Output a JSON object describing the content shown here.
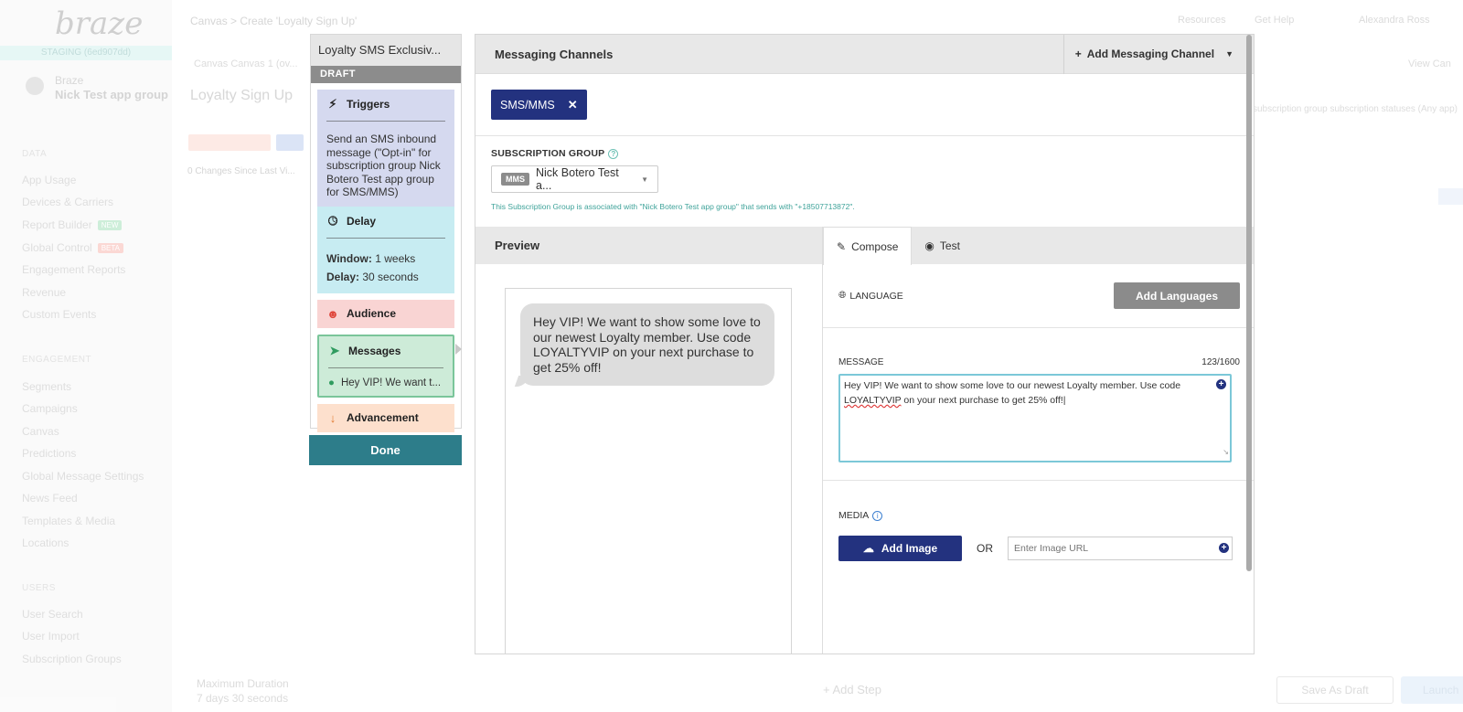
{
  "background": {
    "logo": "braze",
    "env_label": "STAGING (6ed907dd)",
    "company": "Braze",
    "app_group": "Nick Test app group",
    "breadcrumb": "Canvas > Create 'Loyalty Sign Up'",
    "resources": "Resources",
    "get_help": "Get Help",
    "user_name": "Alexandra Ross",
    "page_title": "Loyalty Sign Up",
    "changes": "0 Changes Since Last Vi...",
    "tabs": "Canvas     Canvas 1 (ov...",
    "right_hint": "subscription group subscription statuses (Any app)",
    "view_label": "View Can",
    "nav_head_1": "DATA",
    "nav_items_1": [
      "App Usage",
      "Devices & Carriers",
      "Report Builder",
      "Global Control",
      "Engagement Reports",
      "Revenue",
      "Custom Events"
    ],
    "report_builder_tag": "NEW",
    "global_control_tag": "BETA",
    "nav_head_2": "ENGAGEMENT",
    "nav_items_2": [
      "Segments",
      "Campaigns",
      "Canvas",
      "Predictions",
      "Global Message Settings",
      "News Feed",
      "Templates & Media",
      "Locations"
    ],
    "nav_head_3": "USERS",
    "nav_items_3": [
      "User Search",
      "User Import",
      "Subscription Groups"
    ],
    "max_duration_label": "Maximum Duration",
    "max_duration_value": "7 days 30 seconds",
    "add_step": "Add Step",
    "save_draft": "Save As Draft",
    "launch": "Launch"
  },
  "step_panel": {
    "title": "Loyalty SMS Exclusiv...",
    "status": "DRAFT",
    "triggers": {
      "label": "Triggers",
      "text": "Send an SMS inbound message (\"Opt-in\" for subscription group Nick Botero Test app group for SMS/MMS)"
    },
    "delay": {
      "label": "Delay",
      "window_label": "Window:",
      "window_value": "1 weeks",
      "delay_label": "Delay:",
      "delay_value": "30 seconds"
    },
    "audience": {
      "label": "Audience"
    },
    "messages": {
      "label": "Messages",
      "preview": "Hey VIP! We want t..."
    },
    "advancement": {
      "label": "Advancement"
    },
    "done": "Done"
  },
  "modal": {
    "title": "Messaging Channels",
    "add_channel": "Add Messaging Channel",
    "chip": "SMS/MMS",
    "subscription_group_label": "SUBSCRIPTION GROUP",
    "group_badge": "MMS",
    "group_value": "Nick Botero Test a...",
    "group_note": "This Subscription Group is associated with \"Nick Botero Test app group\" that sends with \"+18507713872\".",
    "preview_label": "Preview",
    "bubble_text": "Hey VIP! We want to show some love to our newest Loyalty member. Use code LOYALTYVIP on your next purchase to get 25% off!",
    "tabs": [
      "Compose",
      "Test"
    ],
    "language_label": "LANGUAGE",
    "add_languages": "Add Languages",
    "message_label": "MESSAGE",
    "char_count": "123/1600",
    "message_part1": "Hey VIP! We want to show some love to our newest Loyalty member. Use code ",
    "message_spell": "LOYALTYVIP",
    "message_part2": " on your next purchase to get 25% off!",
    "media_label": "MEDIA",
    "add_image": "Add Image",
    "or": "OR",
    "url_placeholder": "Enter Image URL"
  },
  "colors": {
    "brand_navy": "#23327f",
    "done_teal": "#2d7d8a",
    "triggers_bg": "#d5d9ef",
    "delay_bg": "#c7ecf2",
    "audience_bg": "#f9d4d3",
    "messages_bg": "#cdebd8",
    "advancement_bg": "#fde0cd"
  }
}
